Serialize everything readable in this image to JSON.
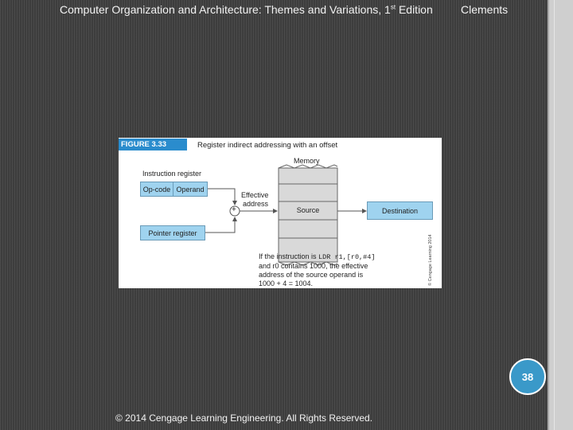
{
  "header": {
    "book_title": "Computer Organization and Architecture: Themes and Variations, 1",
    "edition_sup": "st",
    "edition_suffix": " Edition",
    "author": "Clements"
  },
  "figure": {
    "tag": "FIGURE 3.33",
    "title": "Register indirect addressing with an offset",
    "memory_label": "Memory",
    "instruction_register_label": "Instruction register",
    "opcode_label": "Op-code",
    "operand_label": "Operand",
    "effective_address_line1": "Effective",
    "effective_address_line2": "address",
    "adder_symbol": "+",
    "source_label": "Source",
    "destination_label": "Destination",
    "pointer_register_label": "Pointer register",
    "caption_part1": "If the instruction is ",
    "caption_code": "LDR r1,[r0,#4]",
    "caption_line2": "and r0 contains 1000, the effective",
    "caption_line3": "address of the source operand is",
    "caption_line4": "1000 + 4 = 1004.",
    "side_credit": "© Cengage Learning 2014"
  },
  "slide_number": "38",
  "footer": {
    "copyright": "© 2014 Cengage Learning Engineering. All Rights Reserved."
  },
  "colors": {
    "background": "#3d3d3d",
    "accent": "#3a99c9",
    "figure_tag": "#2a8ccd",
    "box_fill": "#9fd3ef",
    "memory_fill": "#d9d9d9"
  }
}
